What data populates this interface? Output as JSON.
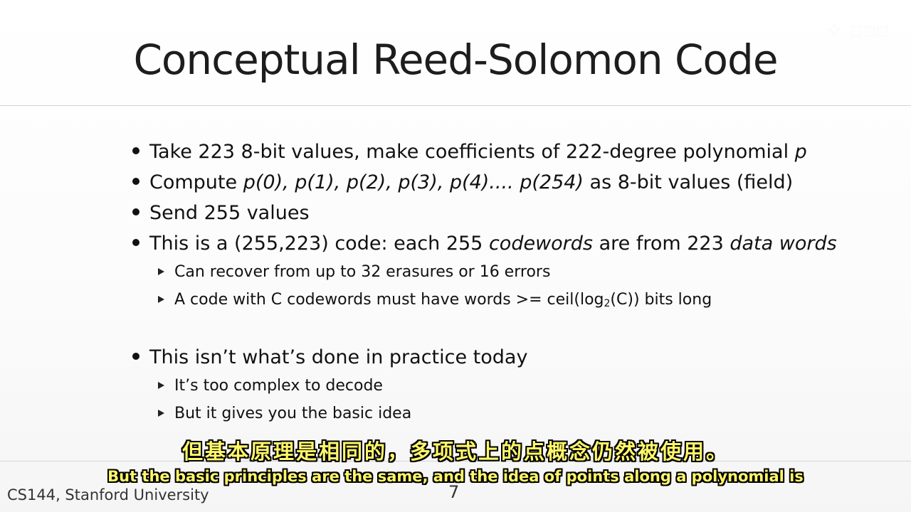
{
  "slide": {
    "title": "Conceptual Reed-Solomon Code",
    "bullets": [
      {
        "parts": [
          {
            "t": "Take 223 8-bit values, make coefficients of 222-degree polynomial "
          },
          {
            "t": "p",
            "i": true
          }
        ]
      },
      {
        "parts": [
          {
            "t": "Compute "
          },
          {
            "t": "p(0), p(1), p(2), p(3), p(4).... p(254)",
            "i": true
          },
          {
            "t": " as 8-bit values (field)"
          }
        ]
      },
      {
        "parts": [
          {
            "t": "Send 255 values"
          }
        ]
      },
      {
        "parts": [
          {
            "t": "This is a (255,223) code: each 255 "
          },
          {
            "t": "codewords",
            "i": true
          },
          {
            "t": " are from 223 "
          },
          {
            "t": "data words",
            "i": true
          }
        ],
        "subs": [
          {
            "parts": [
              {
                "t": "Can recover from up to 32 erasures or 16 errors"
              }
            ]
          },
          {
            "parts": [
              {
                "t": "A code with C codewords must have words >= ceil(log"
              },
              {
                "t": "2",
                "sub": true
              },
              {
                "t": "(C)) bits long"
              }
            ]
          }
        ]
      },
      {
        "parts": [
          {
            "t": "This isn’t what’s done in practice today"
          }
        ],
        "subs": [
          {
            "parts": [
              {
                "t": "It’s too complex to decode"
              }
            ]
          },
          {
            "parts": [
              {
                "t": "But it gives you the basic idea"
              }
            ]
          }
        ]
      }
    ],
    "footer": "CS144, Stanford University",
    "page_number": "7"
  },
  "subtitles": {
    "chinese": "但基本原理是相同的，多项式上的点概念仍然被使用。",
    "english": "But the basic principles are the same, and the idea of points along a polynomial is"
  }
}
